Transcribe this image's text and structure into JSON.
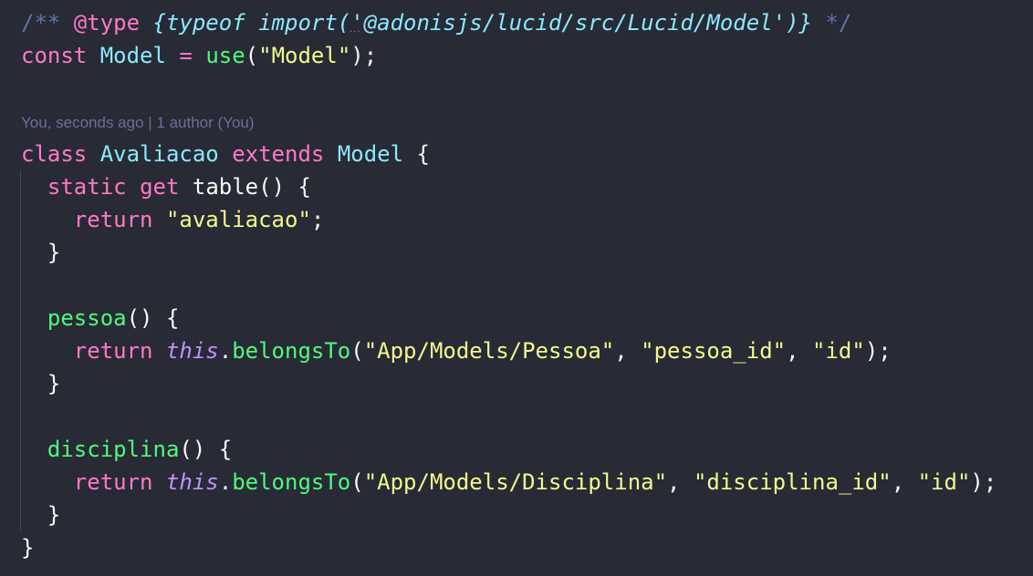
{
  "editor": {
    "theme_colors": {
      "background": "#282a36",
      "keyword": "#ff79c6",
      "class": "#8be9fd",
      "function": "#50fa7b",
      "string": "#f1fa8c",
      "this": "#bd93f9",
      "comment": "#6272a4"
    },
    "codelens": "You, seconds ago | 1 author (You)",
    "lines": [
      [
        [
          "comment",
          "/** "
        ],
        [
          "tag",
          "@type"
        ],
        [
          "plain",
          " "
        ],
        [
          "type",
          "{typeof import('@adonisjs/lucid/src/Lucid/Model')}"
        ],
        [
          "comment",
          " */"
        ]
      ],
      [
        [
          "kw",
          "const"
        ],
        [
          "plain",
          " "
        ],
        [
          "cls",
          "Model"
        ],
        [
          "plain",
          " "
        ],
        [
          "kw",
          "="
        ],
        [
          "plain",
          " "
        ],
        [
          "fn",
          "use"
        ],
        [
          "plain",
          "("
        ],
        [
          "str",
          "\"Model\""
        ],
        [
          "plain",
          ");"
        ]
      ],
      [],
      "LENS",
      [
        [
          "kw",
          "class"
        ],
        [
          "plain",
          " "
        ],
        [
          "cls",
          "Avaliacao"
        ],
        [
          "plain",
          " "
        ],
        [
          "kw",
          "extends"
        ],
        [
          "plain",
          " "
        ],
        [
          "cls",
          "Model"
        ],
        [
          "plain",
          " {"
        ]
      ],
      [
        [
          "plain",
          "  "
        ],
        [
          "kw",
          "static"
        ],
        [
          "plain",
          " "
        ],
        [
          "kw",
          "get"
        ],
        [
          "plain",
          " table() {"
        ]
      ],
      [
        [
          "plain",
          "    "
        ],
        [
          "kw",
          "return"
        ],
        [
          "plain",
          " "
        ],
        [
          "str",
          "\"avaliacao\""
        ],
        [
          "plain",
          ";"
        ]
      ],
      [
        [
          "plain",
          "  }"
        ]
      ],
      [],
      [
        [
          "plain",
          "  "
        ],
        [
          "fn",
          "pessoa"
        ],
        [
          "plain",
          "() {"
        ]
      ],
      [
        [
          "plain",
          "    "
        ],
        [
          "kw",
          "return"
        ],
        [
          "plain",
          " "
        ],
        [
          "this",
          "this"
        ],
        [
          "plain",
          "."
        ],
        [
          "fn",
          "belongsTo"
        ],
        [
          "plain",
          "("
        ],
        [
          "str",
          "\"App/Models/Pessoa\""
        ],
        [
          "plain",
          ", "
        ],
        [
          "str",
          "\"pessoa_id\""
        ],
        [
          "plain",
          ", "
        ],
        [
          "str",
          "\"id\""
        ],
        [
          "plain",
          ");"
        ]
      ],
      [
        [
          "plain",
          "  }"
        ]
      ],
      [],
      [
        [
          "plain",
          "  "
        ],
        [
          "fn",
          "disciplina"
        ],
        [
          "plain",
          "() {"
        ]
      ],
      [
        [
          "plain",
          "    "
        ],
        [
          "kw",
          "return"
        ],
        [
          "plain",
          " "
        ],
        [
          "this",
          "this"
        ],
        [
          "plain",
          "."
        ],
        [
          "fn",
          "belongsTo"
        ],
        [
          "plain",
          "("
        ],
        [
          "str",
          "\"App/Models/Disciplina\""
        ],
        [
          "plain",
          ", "
        ],
        [
          "str",
          "\"disciplina_id\""
        ],
        [
          "plain",
          ", "
        ],
        [
          "str",
          "\"id\""
        ],
        [
          "plain",
          ");"
        ]
      ],
      [
        [
          "plain",
          "  }"
        ]
      ],
      [
        [
          "plain",
          "}"
        ]
      ]
    ]
  }
}
